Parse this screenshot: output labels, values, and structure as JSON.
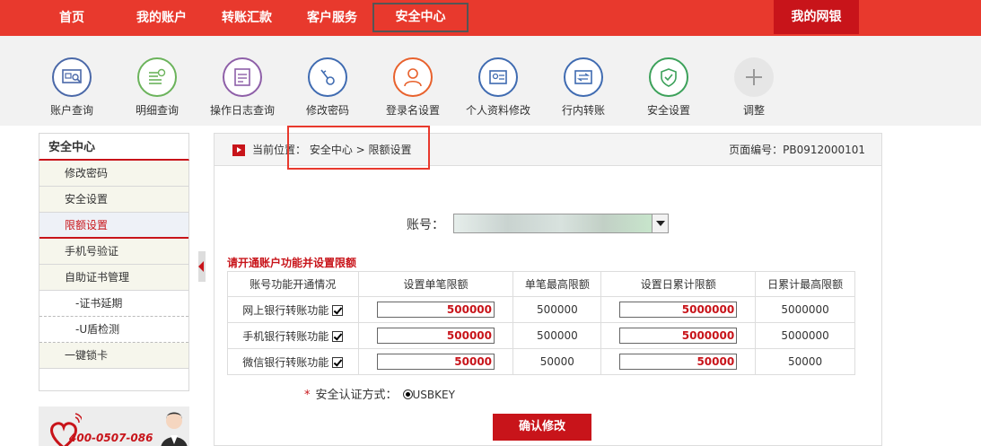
{
  "topnav": {
    "items": [
      "首页",
      "我的账户",
      "转账汇款",
      "客户服务",
      "安全中心"
    ],
    "active_index": 4,
    "mybank": "我的网银"
  },
  "iconbar": {
    "items": [
      {
        "label": "账户查询",
        "icon": "account-query-icon",
        "color": "#4a68a8"
      },
      {
        "label": "明细查询",
        "icon": "detail-query-icon",
        "color": "#6bb35b"
      },
      {
        "label": "操作日志查询",
        "icon": "log-query-icon",
        "color": "#8e5fa8"
      },
      {
        "label": "修改密码",
        "icon": "key-icon",
        "color": "#3f6bb1"
      },
      {
        "label": "登录名设置",
        "icon": "user-icon",
        "color": "#e8612c"
      },
      {
        "label": "个人资料修改",
        "icon": "profile-card-icon",
        "color": "#3f6bb1"
      },
      {
        "label": "行内转账",
        "icon": "transfer-icon",
        "color": "#3f6bb1"
      },
      {
        "label": "安全设置",
        "icon": "shield-icon",
        "color": "#3ca15a"
      },
      {
        "label": "调整",
        "icon": "plus-icon",
        "color": "#cccccc"
      }
    ]
  },
  "sidebar": {
    "title": "安全中心",
    "items": [
      {
        "label": "修改密码",
        "type": "item"
      },
      {
        "label": "安全设置",
        "type": "item"
      },
      {
        "label": "限额设置",
        "type": "active"
      },
      {
        "label": "手机号验证",
        "type": "item"
      },
      {
        "label": "自助证书管理",
        "type": "item"
      },
      {
        "label": "-证书延期",
        "type": "sub"
      },
      {
        "label": "-U盾检测",
        "type": "sub"
      },
      {
        "label": "一键锁卡",
        "type": "item"
      }
    ],
    "promo_phone": "400-0507-086"
  },
  "breadcrumb": {
    "prefix": "当前位置：",
    "path": "安全中心 > 限额设置",
    "page_no": "页面编号：PB0912000101"
  },
  "account": {
    "label": "账号："
  },
  "limits": {
    "section_title": "请开通账户功能并设置限额",
    "headers": [
      "账号功能开通情况",
      "设置单笔限额",
      "单笔最高限额",
      "设置日累计限额",
      "日累计最高限额"
    ],
    "rows": [
      {
        "func": "网上银行转账功能",
        "checked": true,
        "single": "500000",
        "single_max": "500000",
        "daily": "5000000",
        "daily_max": "5000000"
      },
      {
        "func": "手机银行转账功能",
        "checked": true,
        "single": "500000",
        "single_max": "500000",
        "daily": "5000000",
        "daily_max": "5000000"
      },
      {
        "func": "微信银行转账功能",
        "checked": true,
        "single": "50000",
        "single_max": "50000",
        "daily": "50000",
        "daily_max": "50000"
      }
    ]
  },
  "auth": {
    "star": "*",
    "label": "安全认证方式：",
    "option": "USBKEY"
  },
  "confirm_label": "确认修改",
  "colors": {
    "brand_red": "#e8392d",
    "dark_red": "#c8141a"
  }
}
